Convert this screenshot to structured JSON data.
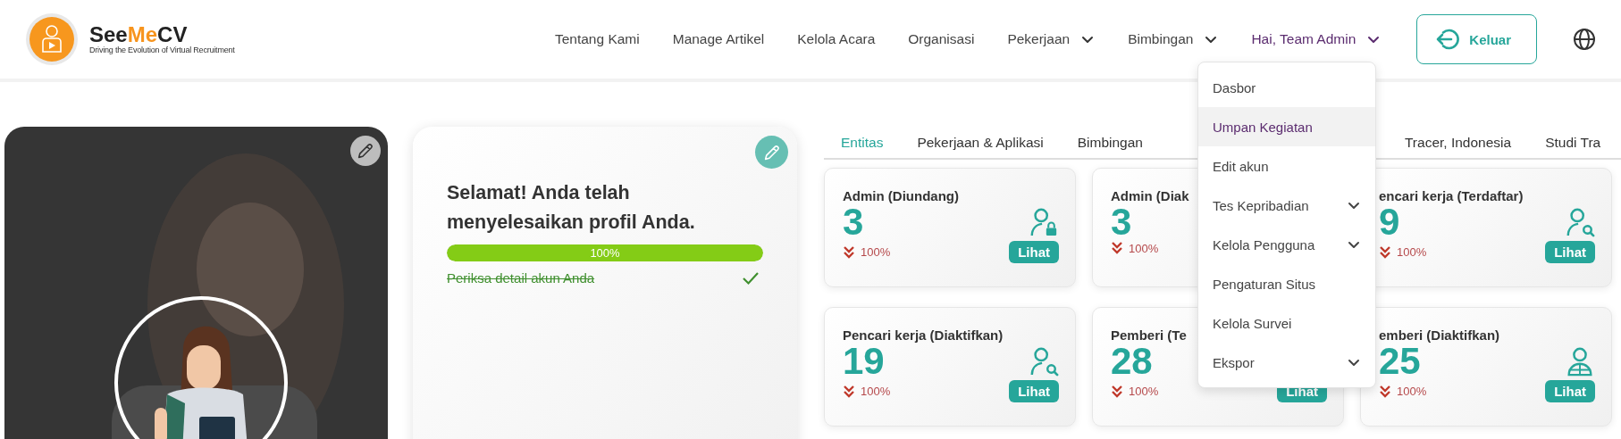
{
  "header": {
    "brand": {
      "prefix": "See",
      "highlight": "Me",
      "suffix": "CV",
      "tagline": "Driving the Evolution of Virtual Recruitment"
    },
    "nav": [
      {
        "label": "Tentang Kami",
        "kind": "link"
      },
      {
        "label": "Manage Artikel",
        "kind": "link"
      },
      {
        "label": "Kelola Acara",
        "kind": "link"
      },
      {
        "label": "Organisasi",
        "kind": "link"
      },
      {
        "label": "Pekerjaan",
        "kind": "dropdown",
        "expanded": false
      },
      {
        "label": "Bimbingan",
        "kind": "dropdown",
        "expanded": false
      },
      {
        "label": "Hai, Team Admin",
        "kind": "dropdown",
        "expanded": true
      }
    ],
    "logout_button": "Keluar"
  },
  "user_menu": [
    {
      "label": "Dasbor",
      "selected": false,
      "has_submenu": false
    },
    {
      "label": "Umpan Kegiatan",
      "selected": true,
      "has_submenu": false
    },
    {
      "label": "Edit akun",
      "selected": false,
      "has_submenu": false
    },
    {
      "label": "Tes Kepribadian",
      "selected": false,
      "has_submenu": true
    },
    {
      "label": "Kelola Pengguna",
      "selected": false,
      "has_submenu": true
    },
    {
      "label": "Pengaturan Situs",
      "selected": false,
      "has_submenu": false
    },
    {
      "label": "Kelola Survei",
      "selected": false,
      "has_submenu": false
    },
    {
      "label": "Ekspor",
      "selected": false,
      "has_submenu": true
    }
  ],
  "profile_progress": {
    "title": "Selamat! Anda telah menyelesaikan profil Anda.",
    "level": 1,
    "reading": "100%",
    "tasks": [
      {
        "label": "Periksa detail akun Anda",
        "done": true
      }
    ]
  },
  "tabs": [
    {
      "label": "Entitas",
      "selected": true
    },
    {
      "label": "Pekerjaan & Aplikasi",
      "selected": false
    },
    {
      "label": "Bimbingan",
      "selected": false
    },
    {
      "label": "Tracer, Indonesia",
      "selected": false
    },
    {
      "label": "Studi Tra",
      "selected": false
    }
  ],
  "stat_cards": [
    {
      "title": "Admin (Diundang)",
      "count": "3",
      "change": "100%",
      "kind": "admin",
      "button": "Lihat"
    },
    {
      "title": "Admin (Diak",
      "count": "3",
      "change": "100%"
    },
    {
      "title": "encari kerja (Terdaftar)",
      "count": "9",
      "change": "100%",
      "kind": "seeker",
      "button": "Lihat"
    },
    {
      "title": "Pencari kerja (Diaktifkan)",
      "count": "19",
      "change": "100%",
      "kind": "seeker",
      "button": "Lihat"
    },
    {
      "title": "Pemberi (Te",
      "count": "28",
      "change": "100%",
      "button": "Lihat"
    },
    {
      "title": "emberi (Diaktifkan)",
      "count": "25",
      "change": "100%",
      "kind": "employer",
      "button": "Lihat"
    }
  ]
}
